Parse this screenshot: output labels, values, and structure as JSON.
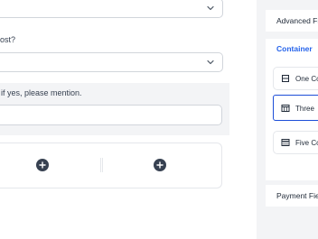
{
  "form": {
    "q1_select_value": "",
    "q2_label": "ost?",
    "q2_select_value": "",
    "q3_label": "if yes, please mention.",
    "q3_input_value": ""
  },
  "sidebar": {
    "advanced_title": "Advanced Fi",
    "container_title": "Container",
    "items": [
      {
        "label": "One Co",
        "icon": "one-column-icon"
      },
      {
        "label": "Three",
        "icon": "three-column-icon"
      },
      {
        "label": "Five Co",
        "icon": "five-column-icon"
      }
    ],
    "payment_title": "Payment Fie"
  },
  "colors": {
    "accent": "#1d4ed8",
    "container_title": "#2563eb",
    "sidebar_bg": "#f3f4f6"
  }
}
